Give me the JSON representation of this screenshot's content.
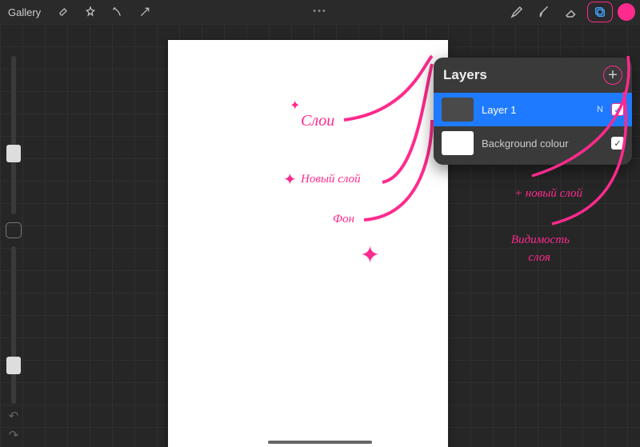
{
  "topbar": {
    "gallery": "Gallery",
    "ellipsis": "•••"
  },
  "canvas_notes": {
    "sloi": "Слои",
    "novyi": "Новый слой",
    "fon": "Фон"
  },
  "annotations": {
    "new_layer": "+ новый слой",
    "visibility1": "Видимость",
    "visibility2": "слоя"
  },
  "layers_panel": {
    "title": "Layers",
    "layer1_name": "Layer 1",
    "layer1_blend": "N",
    "bg_name": "Background colour"
  },
  "colors": {
    "accent": "#ff2a8d",
    "selected": "#1e7bff"
  }
}
